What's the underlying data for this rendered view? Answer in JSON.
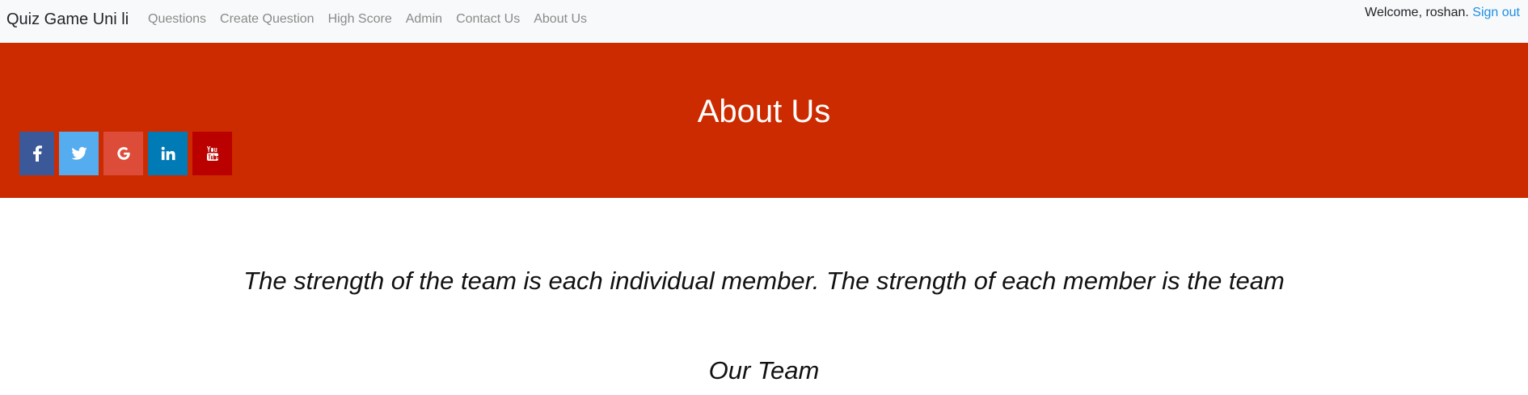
{
  "navbar": {
    "brand": "Quiz Game Uni li",
    "links": [
      {
        "label": "Questions"
      },
      {
        "label": "Create Question"
      },
      {
        "label": "High Score"
      },
      {
        "label": "Admin"
      },
      {
        "label": "Contact Us"
      },
      {
        "label": "About Us"
      }
    ],
    "welcome_text": "Welcome, roshan.",
    "signout_label": "Sign out",
    "background_color": "#f8f9fa",
    "link_color": "#8a8a8a",
    "signout_color": "#1e8fe6"
  },
  "hero": {
    "title": "About Us",
    "background_color": "#cc2b00",
    "social": [
      {
        "icon": "facebook-icon",
        "color": "#3b5998"
      },
      {
        "icon": "twitter-icon",
        "color": "#55acee"
      },
      {
        "icon": "google-icon",
        "color": "#dd4b39"
      },
      {
        "icon": "linkedin-icon",
        "color": "#007bb5"
      },
      {
        "icon": "youtube-icon",
        "color": "#bb0000"
      }
    ]
  },
  "content": {
    "quote": "The strength of the team is each individual member. The strength of each member is the team",
    "team_heading": "Our Team"
  }
}
